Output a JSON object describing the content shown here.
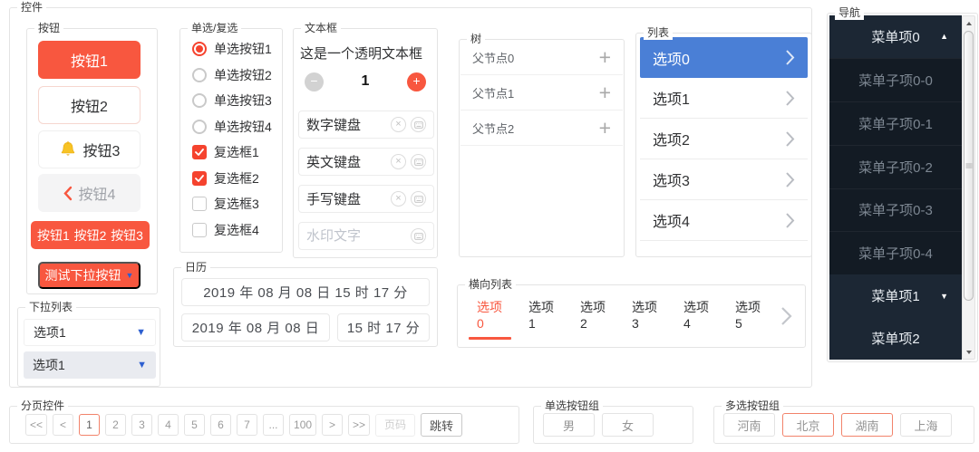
{
  "colors": {
    "accent_red": "#f8573f",
    "check_red": "#f5432e",
    "list_selected_blue": "#4a7fd6",
    "dropdown_arrow_blue": "#2d5fd0",
    "nav_parent_bg": "#1c2734",
    "nav_child_bg": "#131b24",
    "current_page_border": "#f2836b"
  },
  "icons": {
    "triangle_up": "▲",
    "triangle_down": "▼",
    "minus": "−",
    "plus": "+",
    "clear": "×",
    "ellipsis": "..."
  },
  "controls": {
    "legend": "控件"
  },
  "buttons": {
    "legend": "按钮",
    "btn1": "按钮1",
    "btn2": "按钮2",
    "btn3": "按钮3",
    "btn4": "按钮4",
    "group_items": [
      "按钮1",
      "按钮2",
      "按钮3"
    ],
    "dropdown_btn": "测试下拉按钮"
  },
  "dropdown": {
    "legend": "下拉列表",
    "items": [
      {
        "label": "选项1"
      },
      {
        "label": "选项1"
      }
    ]
  },
  "radio_check": {
    "legend": "单选/复选",
    "radios": [
      {
        "label": "单选按钮1",
        "checked": true
      },
      {
        "label": "单选按钮2",
        "checked": false
      },
      {
        "label": "单选按钮3",
        "checked": false
      },
      {
        "label": "单选按钮4",
        "checked": false
      }
    ],
    "checkboxes": [
      {
        "label": "复选框1",
        "checked": true
      },
      {
        "label": "复选框2",
        "checked": true
      },
      {
        "label": "复选框3",
        "checked": false
      },
      {
        "label": "复选框4",
        "checked": false
      }
    ]
  },
  "textbox": {
    "legend": "文本框",
    "transparent_text": "这是一个透明文本框",
    "stepper_value": "1",
    "inputs": [
      {
        "value": "数字键盘"
      },
      {
        "value": "英文键盘"
      },
      {
        "value": "手写键盘"
      },
      {
        "placeholder": "水印文字"
      }
    ]
  },
  "calendar": {
    "legend": "日历",
    "row1": "2019 年 08 月 08 日 15 时 17 分",
    "row2_date": "2019 年 08 月 08 日",
    "row2_time": "15 时 17 分"
  },
  "tree": {
    "legend": "树",
    "nodes": [
      "父节点0",
      "父节点1",
      "父节点2"
    ]
  },
  "hlist": {
    "legend": "横向列表",
    "items": [
      "选项0",
      "选项1",
      "选项2",
      "选项3",
      "选项4",
      "选项5"
    ],
    "selected": "选项0"
  },
  "list": {
    "legend": "列表",
    "items": [
      "选项0",
      "选项1",
      "选项2",
      "选项3",
      "选项4"
    ],
    "selected": "选项0"
  },
  "nav": {
    "legend": "导航",
    "items": [
      {
        "label": "菜单项0",
        "arrow": "▲"
      },
      {
        "label": "菜单子项0-0"
      },
      {
        "label": "菜单子项0-1"
      },
      {
        "label": "菜单子项0-2"
      },
      {
        "label": "菜单子项0-3"
      },
      {
        "label": "菜单子项0-4"
      },
      {
        "label": "菜单项1",
        "arrow": "▼"
      },
      {
        "label": "菜单项2"
      }
    ]
  },
  "pagination": {
    "legend": "分页控件",
    "buttons": [
      "<<",
      "<",
      "1",
      "2",
      "3",
      "4",
      "5",
      "6",
      "7",
      "...",
      "100",
      ">",
      ">>"
    ],
    "current_page": "1",
    "page_placeholder": "页码",
    "jump_label": "跳转"
  },
  "radio_group": {
    "legend": "单选按钮组",
    "options": [
      "男",
      "女"
    ]
  },
  "multi_group": {
    "legend": "多选按钮组",
    "options": [
      {
        "label": "河南",
        "selected": false
      },
      {
        "label": "北京",
        "selected": true
      },
      {
        "label": "湖南",
        "selected": true
      },
      {
        "label": "上海",
        "selected": false
      }
    ]
  }
}
